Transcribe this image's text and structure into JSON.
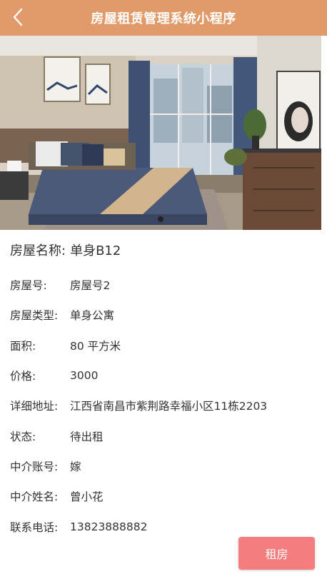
{
  "header": {
    "title": "房屋租赁管理系统小程序",
    "back_icon": "chevron-left-icon"
  },
  "colors": {
    "header_bg": "#e19b6b",
    "rent_button_bg": "#f47d7d"
  },
  "house": {
    "name_label": "房屋名称:",
    "name_value": "单身B12",
    "fields": [
      {
        "label": "房屋号:",
        "value": "房屋号2"
      },
      {
        "label": "房屋类型:",
        "value": "单身公寓"
      },
      {
        "label": "面积:",
        "value": "80 平方米"
      },
      {
        "label": "价格:",
        "value": "3000"
      },
      {
        "label": "详细地址:",
        "value": "江西省南昌市紫荆路幸福小区11栋2203"
      },
      {
        "label": "状态:",
        "value": "待出租"
      },
      {
        "label": "中介账号:",
        "value": "嫁"
      },
      {
        "label": "中介姓名:",
        "value": "曾小花"
      },
      {
        "label": "联系电话:",
        "value": "13823888882"
      }
    ]
  },
  "actions": {
    "rent_label": "租房"
  }
}
